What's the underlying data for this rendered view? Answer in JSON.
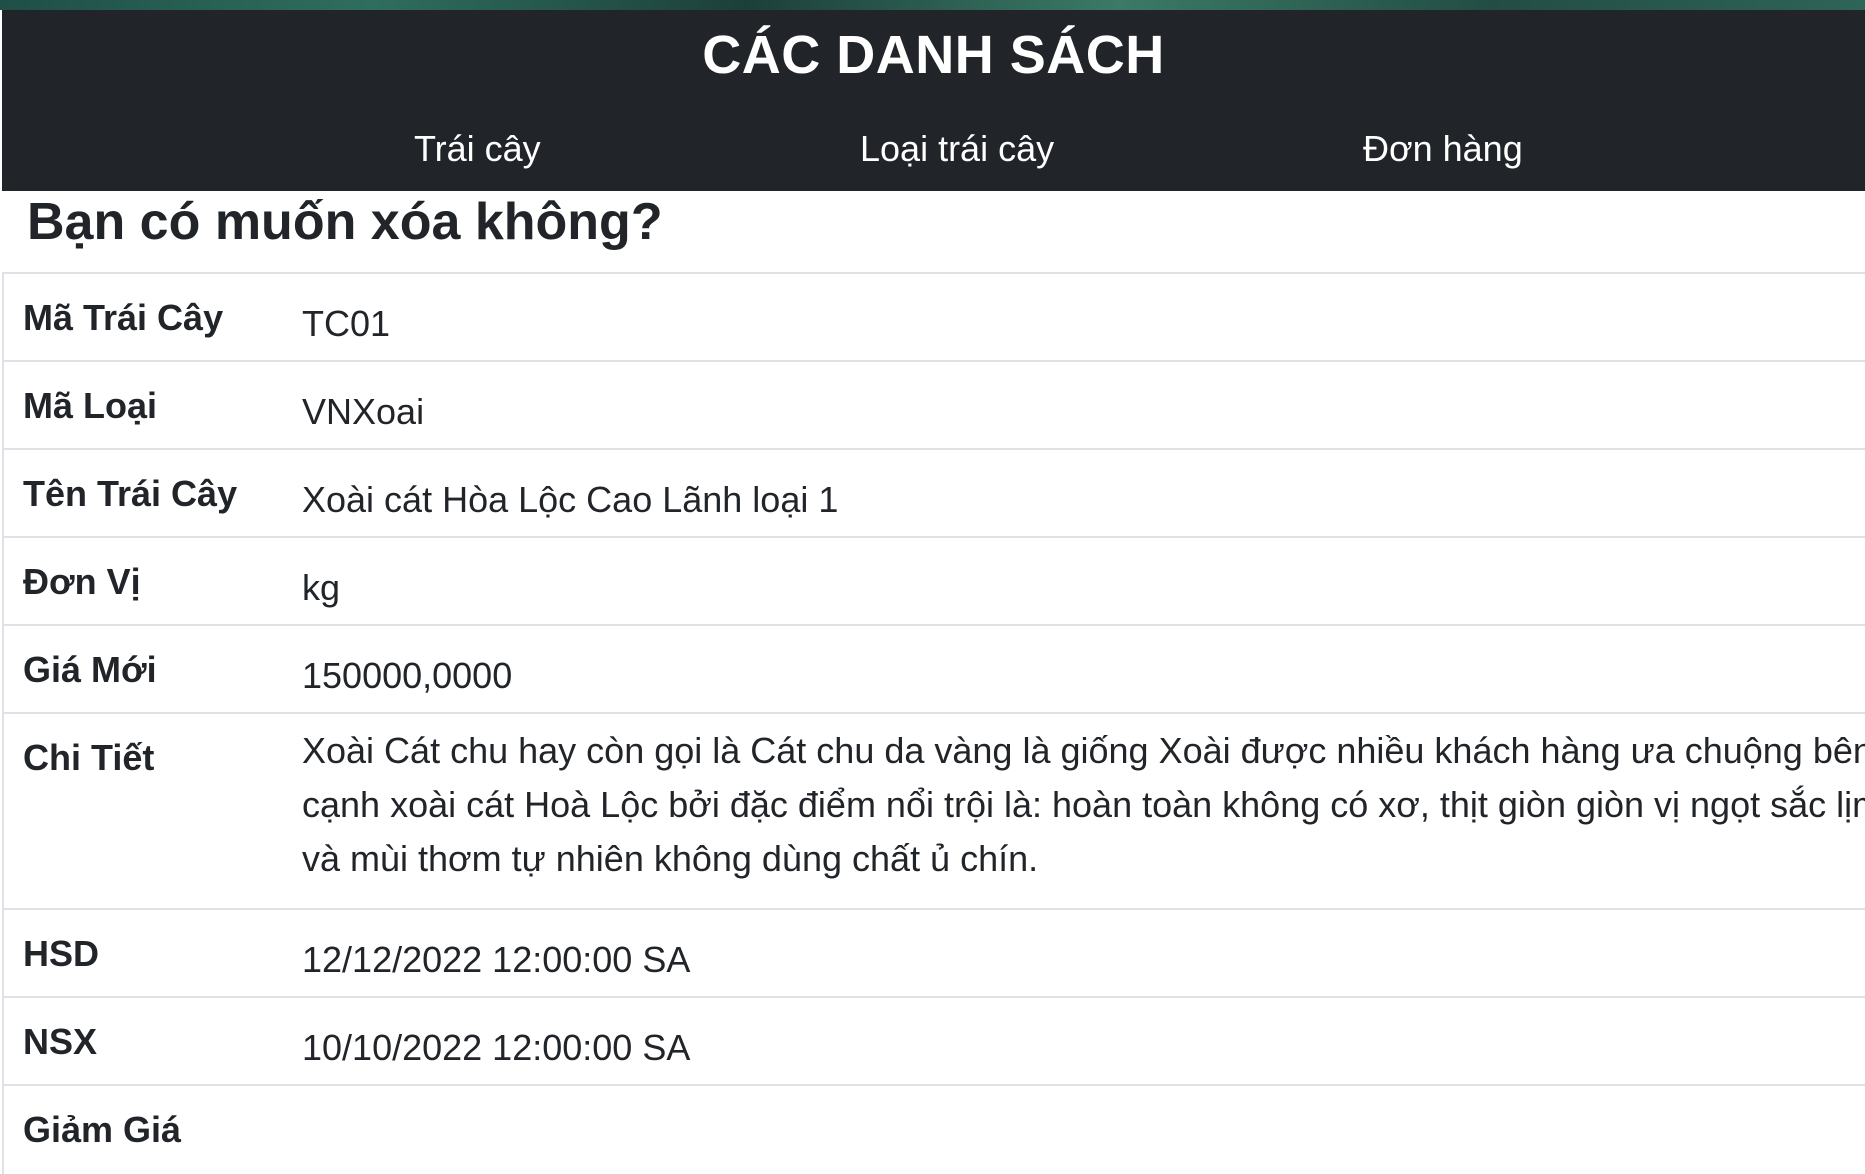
{
  "navbar": {
    "brand": "CÁC DANH SÁCH",
    "links": [
      "Trái cây",
      "Loại trái cây",
      "Đơn hàng"
    ]
  },
  "page": {
    "title": "Bạn có muốn xóa không?"
  },
  "details": [
    {
      "label": "Mã Trái Cây",
      "value": "TC01"
    },
    {
      "label": "Mã Loại",
      "value": "VNXoai"
    },
    {
      "label": "Tên Trái Cây",
      "value": "Xoài cát Hòa Lộc Cao Lãnh loại 1"
    },
    {
      "label": "Đơn Vị",
      "value": "kg"
    },
    {
      "label": "Giá Mới",
      "value": "150000,0000"
    },
    {
      "label": "Chi Tiết",
      "value": "Xoài Cát chu hay còn gọi là Cát chu da vàng là giống Xoài được nhiều khách hàng ưa chuộng bên cạnh xoài cát Hoà Lộc bởi đặc điểm nổi trội là: hoàn toàn không có xơ, thịt giòn giòn vị ngọt sắc lịm và mùi thơm tự nhiên không dùng chất ủ chín."
    },
    {
      "label": "HSD",
      "value": "12/12/2022 12:00:00 SA"
    },
    {
      "label": "NSX",
      "value": "10/10/2022 12:00:00 SA"
    },
    {
      "label": "Giảm Giá",
      "value": ""
    }
  ]
}
